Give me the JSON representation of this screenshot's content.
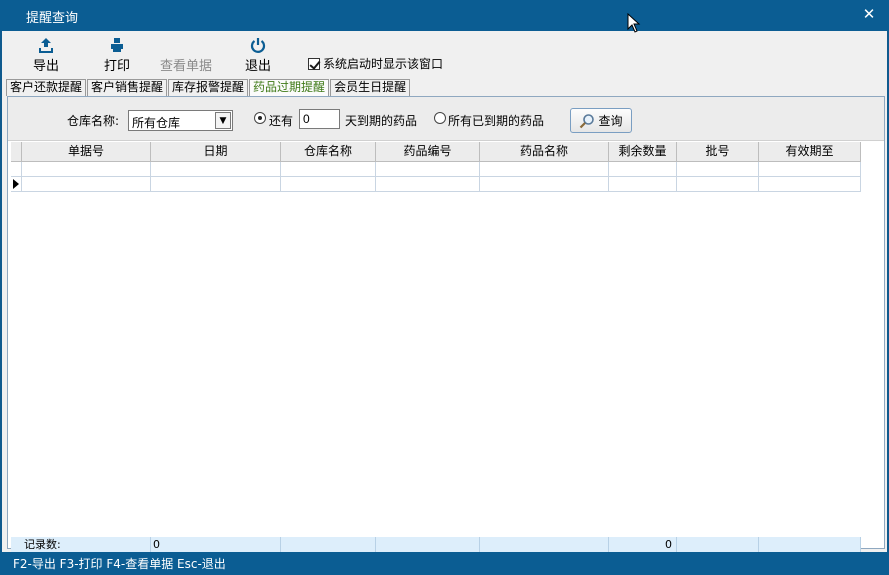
{
  "window": {
    "title": "提醒查询",
    "close_label": "✕"
  },
  "toolbar": {
    "export_label": "导出",
    "print_label": "打印",
    "view_label": "查看单据",
    "exit_label": "退出",
    "startup_checkbox_label": "系统启动时显示该窗口",
    "startup_checked": true
  },
  "tabs": [
    {
      "label": "客户还款提醒",
      "active": false
    },
    {
      "label": "客户销售提醒",
      "active": false
    },
    {
      "label": "库存报警提醒",
      "active": false
    },
    {
      "label": "药品过期提醒",
      "active": true
    },
    {
      "label": "会员生日提醒",
      "active": false
    }
  ],
  "filter": {
    "warehouse_label": "仓库名称:",
    "warehouse_value": "所有仓库",
    "radio_remaining_label": "还有",
    "days_value": "0",
    "days_suffix": "天到期的药品",
    "radio_all_expired_label": "所有已到期的药品",
    "query_button": "查询"
  },
  "table": {
    "columns": [
      "单据号",
      "日期",
      "仓库名称",
      "药品编号",
      "药品名称",
      "剩余数量",
      "批号",
      "有效期至"
    ],
    "rows": [
      [
        "",
        "",
        "",
        "",
        "",
        "",
        "",
        ""
      ],
      [
        "",
        "",
        "",
        "",
        "",
        "",
        "",
        ""
      ]
    ]
  },
  "summary": {
    "label": "记录数:",
    "count": "0",
    "quantity_total": "0"
  },
  "statusbar": {
    "hotkeys": "F2-导出 F3-打印 F4-查看单据 Esc-退出"
  },
  "colors": {
    "titlebar": "#0b5d93",
    "active_tab_text": "#3f7a17",
    "footer_bg": "#ddeefb"
  }
}
